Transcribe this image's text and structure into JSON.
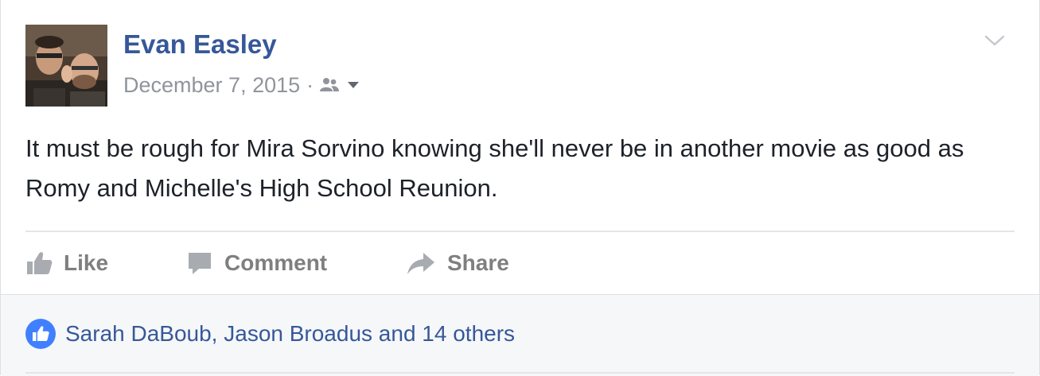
{
  "post": {
    "author_name": "Evan Easley",
    "date": "December 7, 2015",
    "separator": "·",
    "privacy_icon": "friends-icon",
    "options_icon": "chevron-down-icon",
    "text": "It must be rough for Mira Sorvino knowing she'll never be in another movie as good as Romy and Michelle's High School Reunion."
  },
  "actions": {
    "like_label": "Like",
    "comment_label": "Comment",
    "share_label": "Share"
  },
  "reactions": {
    "summary": "Sarah DaBoub, Jason Broadus and 14 others",
    "icon": "like-badge-icon"
  },
  "colors": {
    "link_blue": "#365899",
    "like_blue": "#4080ff",
    "muted_gray": "#90949c",
    "action_gray": "#7f7f7f",
    "text": "#1d2129"
  }
}
